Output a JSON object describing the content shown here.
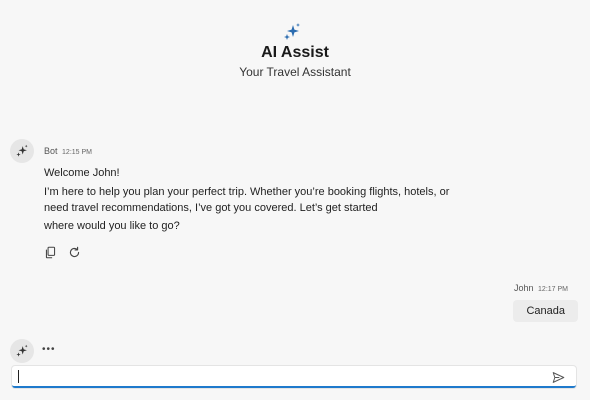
{
  "header": {
    "icon": "sparkle-icon",
    "title": "AI Assist",
    "subtitle": "Your Travel Assistant"
  },
  "messages": {
    "bot": {
      "sender": "Bot",
      "time": "12:15 PM",
      "avatar_icon": "sparkle-icon",
      "lines": [
        "Welcome John!",
        "I’m here to help you plan your perfect trip. Whether you’re booking flights, hotels, or",
        "need travel recommendations, I’ve got you covered. Let’s get started",
        "where would you like to go?"
      ],
      "actions": [
        {
          "icon": "copy-icon"
        },
        {
          "icon": "refresh-icon"
        }
      ]
    },
    "user": {
      "sender": "John",
      "time": "12:17 PM",
      "text": "Canada"
    },
    "typing": {
      "indicator": "•••",
      "avatar_icon": "sparkle-icon"
    }
  },
  "input": {
    "value": "",
    "placeholder": "",
    "send_icon": "send-icon"
  },
  "colors": {
    "background": "#f7f7f7",
    "accent": "#1f7acc",
    "sparkle": "#2b6cb0",
    "user_bubble": "#ececec"
  }
}
